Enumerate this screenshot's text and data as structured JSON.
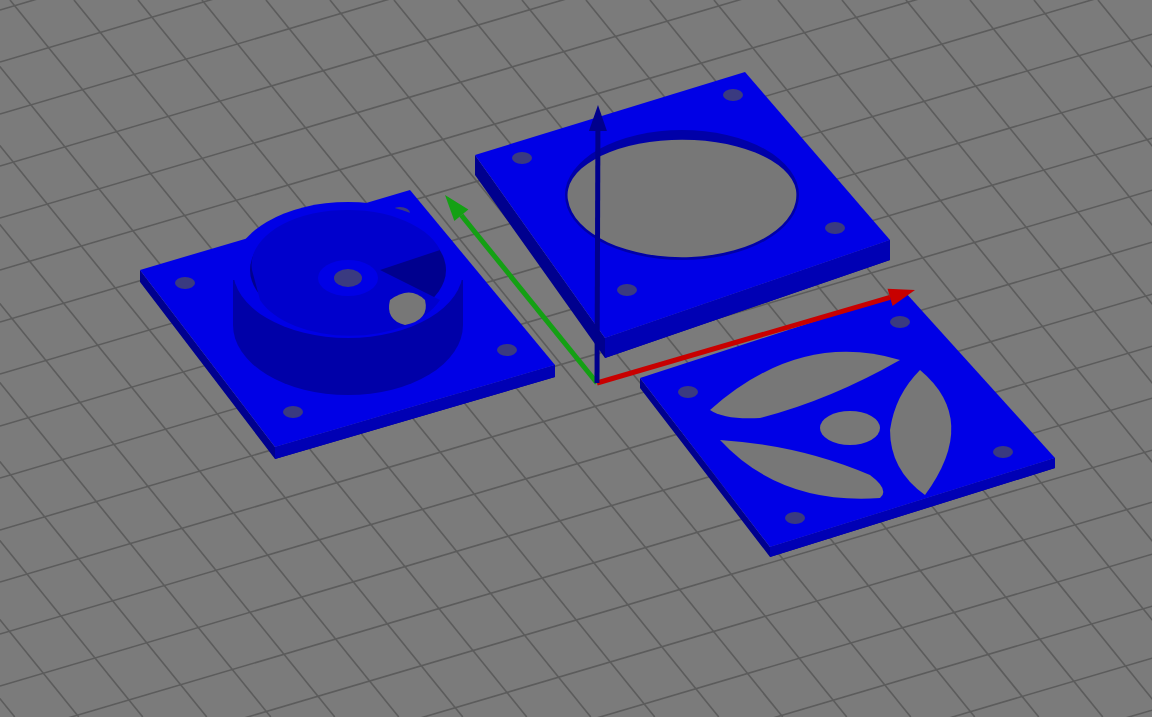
{
  "viewport": {
    "objects": [
      {
        "kind": "ring-plate"
      },
      {
        "kind": "shroud"
      },
      {
        "kind": "grille-plate"
      }
    ],
    "axes": [
      {
        "kind": "x",
        "color": "#c80000"
      },
      {
        "kind": "y",
        "color": "#14a014"
      },
      {
        "kind": "z",
        "color": "#00008c"
      }
    ]
  }
}
